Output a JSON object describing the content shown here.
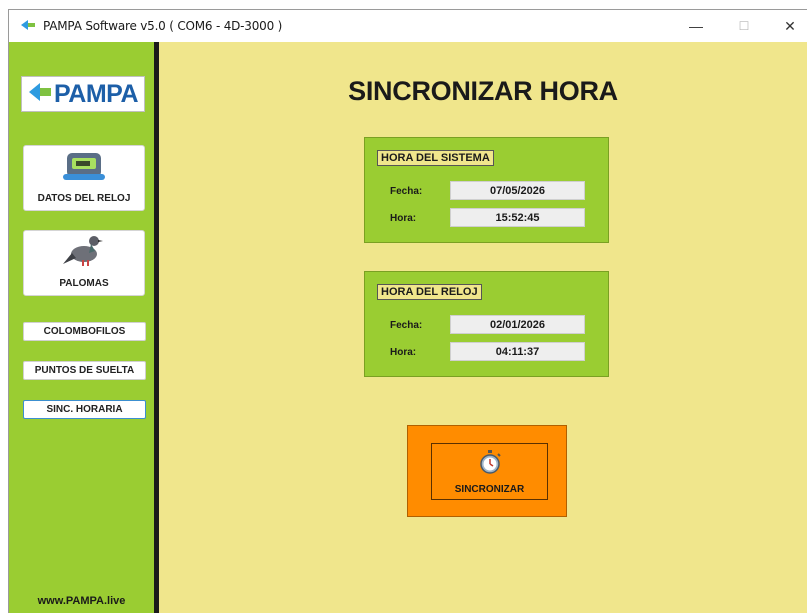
{
  "window": {
    "title": "PAMPA Software v5.0 ( COM6 - 4D-3000 )",
    "controls": {
      "minimize": "—",
      "maximize": "☐",
      "close": "✕"
    }
  },
  "sidebar": {
    "logo_text": "PAMPA",
    "datos_del_reloj": "DATOS DEL RELOJ",
    "palomas": "PALOMAS",
    "colombofilos": "COLOMBOFILOS",
    "puntos_de_suelta": "PUNTOS DE SUELTA",
    "sinc_horaria": "SINC. HORARIA",
    "website": "www.PAMPA.live"
  },
  "main": {
    "title": "SINCRONIZAR HORA",
    "hora_sistema": {
      "legend": "HORA DEL SISTEMA",
      "fecha_label": "Fecha:",
      "fecha_value": "07/05/2026",
      "hora_label": "Hora:",
      "hora_value": "15:52:45"
    },
    "hora_reloj": {
      "legend": "HORA DEL RELOJ",
      "fecha_label": "Fecha:",
      "fecha_value": "02/01/2026",
      "hora_label": "Hora:",
      "hora_value": "04:11:37"
    },
    "sync_button_label": "SINCRONIZAR"
  },
  "colors": {
    "sidebar_green": "#9acd32",
    "main_background": "#f0e68c",
    "sync_orange": "#ff8c00",
    "logo_blue": "#1d5fa8"
  },
  "icons": [
    "app-icon",
    "pampa-logo-icon",
    "clock-device-icon",
    "pigeon-icon",
    "stopwatch-icon"
  ]
}
